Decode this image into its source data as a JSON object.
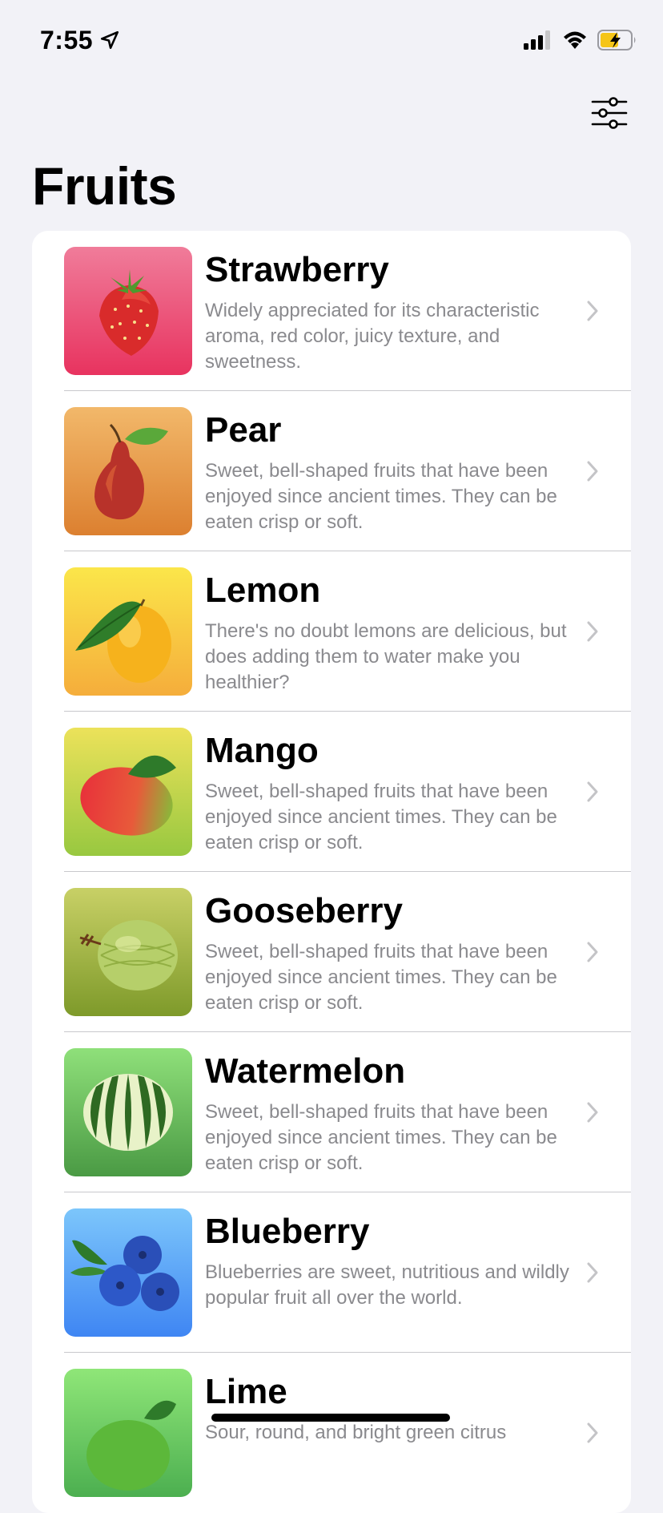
{
  "status_bar": {
    "time": "7:55",
    "icons": [
      "location-arrow-icon",
      "cellular-signal-icon",
      "wifi-icon",
      "battery-charging-icon"
    ]
  },
  "toolbar": {
    "filter_icon": "sliders-icon"
  },
  "page": {
    "title": "Fruits"
  },
  "fruits": [
    {
      "name": "Strawberry",
      "description": "Widely appreciated for its characteristic aroma,  red color, juicy texture, and sweetness.",
      "gradient": [
        "#f07c9a",
        "#e8335f"
      ]
    },
    {
      "name": "Pear",
      "description": "Sweet, bell-shaped fruits that have been enjoyed since ancient times. They can be eaten crisp or soft.",
      "gradient": [
        "#f2b86a",
        "#dc8030"
      ]
    },
    {
      "name": "Lemon",
      "description": "There's no doubt lemons are delicious, but does adding them to water make you healthier?",
      "gradient": [
        "#fbe64a",
        "#f5ad3b"
      ]
    },
    {
      "name": "Mango",
      "description": "Sweet, bell-shaped fruits that have been enjoyed since ancient times. They can be eaten crisp or soft.",
      "gradient": [
        "#ece25a",
        "#98c840"
      ]
    },
    {
      "name": "Gooseberry",
      "description": "Sweet, bell-shaped fruits that have been enjoyed since ancient times. They can be eaten crisp or soft.",
      "gradient": [
        "#c8d066",
        "#7e9a2a"
      ]
    },
    {
      "name": "Watermelon",
      "description": "Sweet, bell-shaped fruits that have been enjoyed since ancient times. They can be eaten crisp or soft.",
      "gradient": [
        "#8fe07a",
        "#4a9a44"
      ]
    },
    {
      "name": "Blueberry",
      "description": "Blueberries are sweet, nutritious and wildly popular fruit all over the world.",
      "gradient": [
        "#7cc6fb",
        "#3f86f3"
      ]
    },
    {
      "name": "Lime",
      "description": "Sour, round, and bright green citrus",
      "gradient": [
        "#8fe678",
        "#4caf50"
      ]
    }
  ]
}
